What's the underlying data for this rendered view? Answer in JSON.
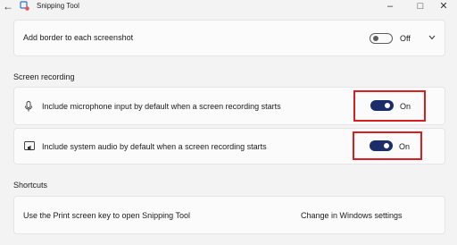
{
  "window": {
    "title": "Snipping Tool",
    "controls": [
      "minimize",
      "maximize",
      "close"
    ]
  },
  "settings": {
    "border": {
      "label": "Add border to each screenshot",
      "state": "Off",
      "enabled": false
    }
  },
  "screen_recording": {
    "heading": "Screen recording",
    "microphone": {
      "label": "Include microphone input by default when a screen recording starts",
      "state": "On",
      "enabled": true
    },
    "system_audio": {
      "label": "Include system audio by default when a screen recording starts",
      "state": "On",
      "enabled": true
    }
  },
  "shortcuts": {
    "heading": "Shortcuts",
    "print_screen": {
      "label": "Use the Print screen key to open Snipping Tool",
      "link": "Change in Windows settings"
    }
  },
  "colors": {
    "toggle_on": "#1c2e6a",
    "highlight": "#d81e1e",
    "background": "#f3f3f3",
    "card": "#fbfbfb"
  }
}
